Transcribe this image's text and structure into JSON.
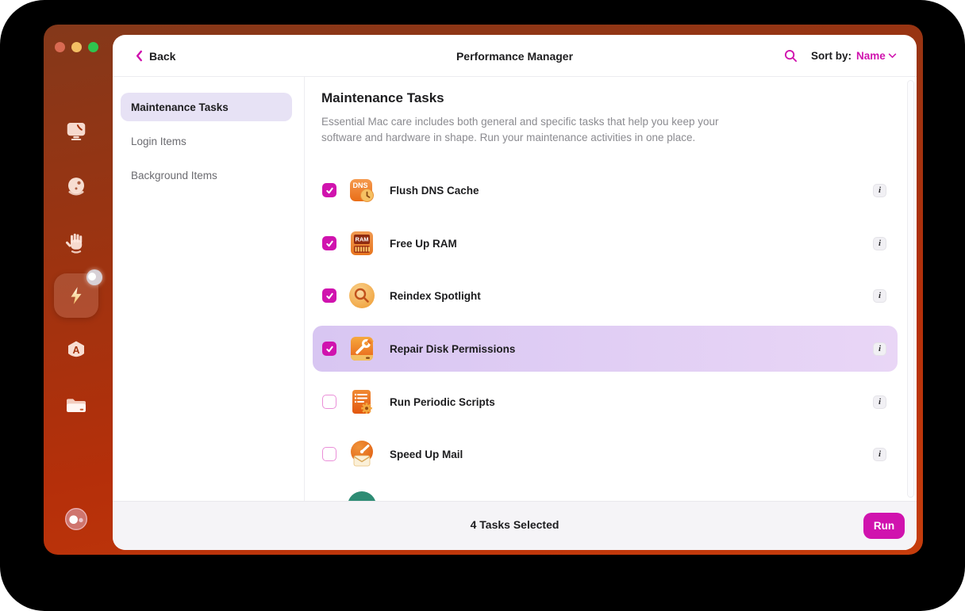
{
  "colors": {
    "accent": "#d013ae",
    "window_frame_top": "#84381a",
    "window_frame_bottom": "#c63d0c",
    "selected_row_start": "#d8c6f2",
    "selected_row_end": "#e9d6f6",
    "sidebar_selected_bg": "#e7e2f5"
  },
  "window": {
    "traffic_lights": [
      "close",
      "minimize",
      "zoom"
    ]
  },
  "rail": {
    "icons": [
      "imac-icon",
      "sphere-icon",
      "hand-icon",
      "lightning-icon",
      "hexagon-a-icon",
      "folder-icon",
      "assistant-avatar-icon"
    ],
    "selected": "lightning-icon"
  },
  "header": {
    "back_label": "Back",
    "title": "Performance Manager",
    "search_icon": "search-icon",
    "sort_by_label": "Sort by:",
    "sort_value": "Name"
  },
  "sidebar": {
    "items": [
      {
        "label": "Maintenance Tasks",
        "selected": true
      },
      {
        "label": "Login Items",
        "selected": false
      },
      {
        "label": "Background Items",
        "selected": false
      }
    ]
  },
  "main": {
    "title": "Maintenance Tasks",
    "description": "Essential Mac care includes both general and specific tasks that help you keep your software and hardware in shape. Run your maintenance activities in one place.",
    "info_icon": "i",
    "tasks": [
      {
        "name": "Flush DNS Cache",
        "icon": "dns-cache-icon",
        "checked": true,
        "highlighted": false
      },
      {
        "name": "Free Up RAM",
        "icon": "free-up-ram-icon",
        "checked": true,
        "highlighted": false
      },
      {
        "name": "Reindex Spotlight",
        "icon": "reindex-spotlight-icon",
        "checked": true,
        "highlighted": false
      },
      {
        "name": "Repair Disk Permissions",
        "icon": "repair-disk-permissions-icon",
        "checked": true,
        "highlighted": true
      },
      {
        "name": "Run Periodic Scripts",
        "icon": "run-periodic-scripts-icon",
        "checked": false,
        "highlighted": false
      },
      {
        "name": "Speed Up Mail",
        "icon": "speed-up-mail-icon",
        "checked": false,
        "highlighted": false
      }
    ]
  },
  "footer": {
    "status": "4 Tasks Selected",
    "run_label": "Run"
  }
}
